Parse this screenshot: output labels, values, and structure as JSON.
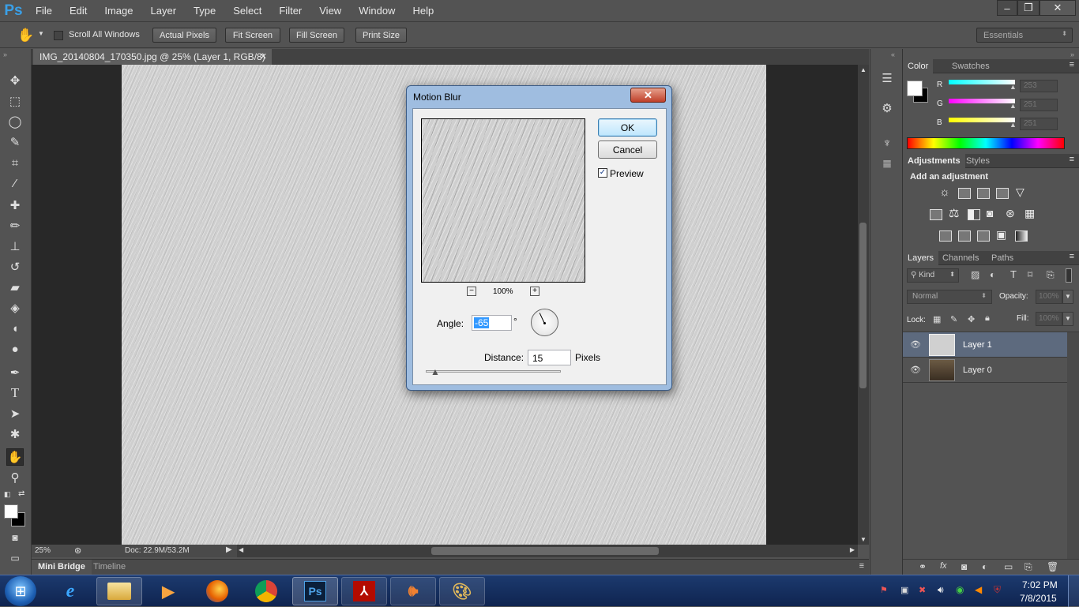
{
  "app": {
    "logo": "Ps",
    "accent": "#3aa0e8"
  },
  "menu": [
    "File",
    "Edit",
    "Image",
    "Layer",
    "Type",
    "Select",
    "Filter",
    "View",
    "Window",
    "Help"
  ],
  "window_controls": {
    "minimize": "–",
    "restore": "❐",
    "close": "✕"
  },
  "options": {
    "scroll_all_windows": "Scroll All Windows",
    "actual_pixels": "Actual Pixels",
    "fit_screen": "Fit Screen",
    "fill_screen": "Fill Screen",
    "print_size": "Print Size",
    "workspace": "Essentials"
  },
  "document": {
    "tab_title": "IMG_20140804_170350.jpg @ 25% (Layer 1, RGB/8) *",
    "zoom": "25%",
    "doc_info": "Doc: 22.9M/53.2M"
  },
  "bottom_tabs": {
    "mini_bridge": "Mini Bridge",
    "timeline": "Timeline"
  },
  "color_panel": {
    "tabs": [
      "Color",
      "Swatches"
    ],
    "channels": [
      {
        "label": "R",
        "value": "253",
        "color": "#00ffff"
      },
      {
        "label": "G",
        "value": "251",
        "color": "#ff00ff"
      },
      {
        "label": "B",
        "value": "251",
        "color": "#ffff00"
      }
    ]
  },
  "adjustments_panel": {
    "tabs": [
      "Adjustments",
      "Styles"
    ],
    "heading": "Add an adjustment"
  },
  "layers_panel": {
    "tabs": [
      "Layers",
      "Channels",
      "Paths"
    ],
    "kind": "Kind",
    "blend_mode": "Normal",
    "opacity_label": "Opacity:",
    "opacity_value": "100%",
    "lock_label": "Lock:",
    "fill_label": "Fill:",
    "fill_value": "100%",
    "layers": [
      {
        "name": "Layer 1",
        "selected": true
      },
      {
        "name": "Layer 0",
        "selected": false
      }
    ]
  },
  "dialog": {
    "title": "Motion Blur",
    "ok": "OK",
    "cancel": "Cancel",
    "preview_label": "Preview",
    "preview_checked": true,
    "zoom": "100%",
    "angle_label": "Angle:",
    "angle_value": "-65",
    "degree_symbol": "°",
    "distance_label": "Distance:",
    "distance_value": "15",
    "pixels_label": "Pixels"
  },
  "taskbar": {
    "time": "7:02 PM",
    "date": "7/8/2015",
    "ps_label": "Ps"
  }
}
